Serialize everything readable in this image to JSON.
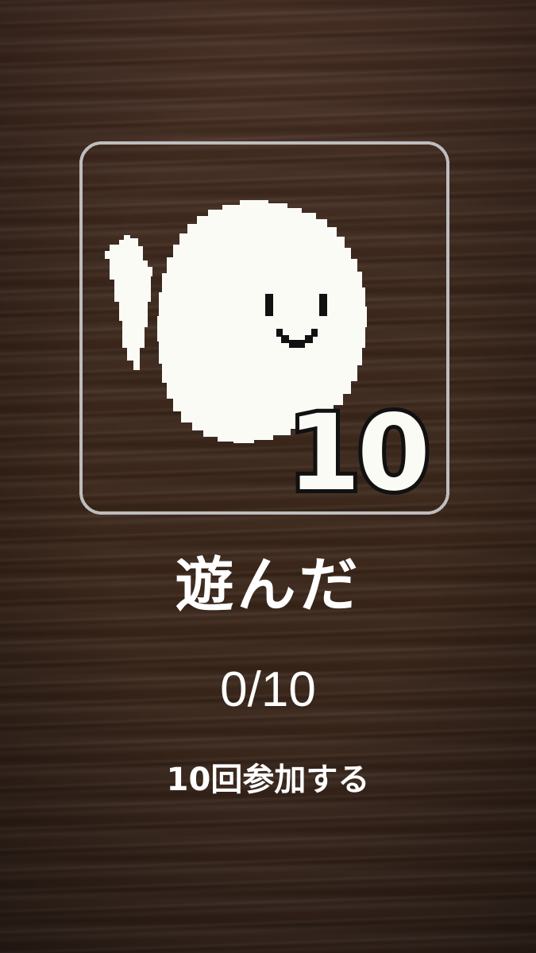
{
  "achievement": {
    "title": "遊んだ",
    "progress": "0/10",
    "description": "10回参加する",
    "badge_number": "10",
    "badge_icon": "waving-ghost-icon",
    "progress_current": 0,
    "progress_target": 10
  },
  "colors": {
    "frame": "#bdbdbd",
    "ghost": "#fbfbf6",
    "outline": "#111111",
    "text": "#ffffff",
    "wood": "#3d281c"
  }
}
